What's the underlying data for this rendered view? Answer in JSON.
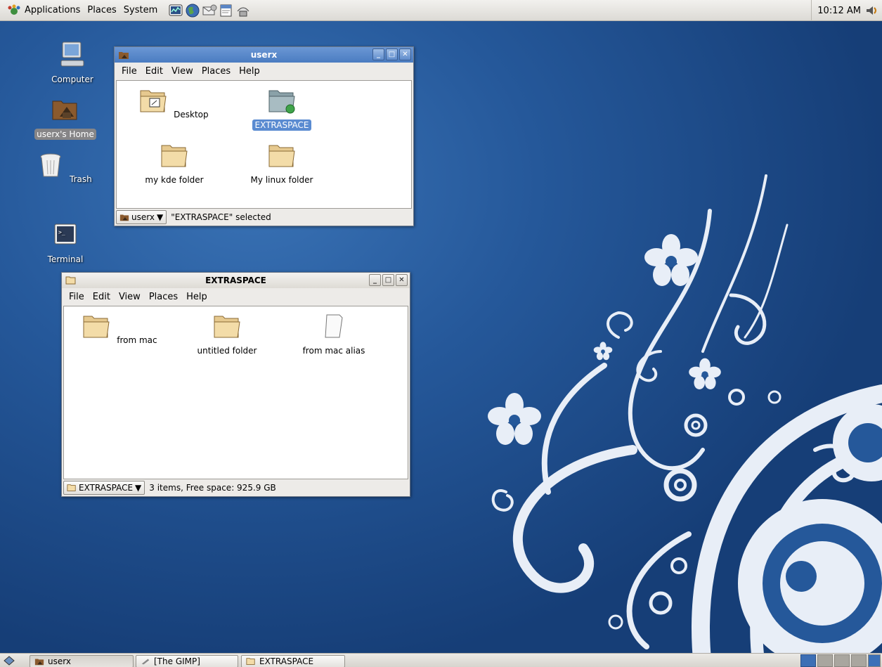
{
  "top_panel": {
    "menus": [
      "Applications",
      "Places",
      "System"
    ],
    "launchers": [
      "system-monitor-icon",
      "web-browser-icon",
      "email-icon",
      "text-editor-icon",
      "network-icon"
    ],
    "clock": "10:12 AM"
  },
  "desktop_icons": [
    {
      "label": "Computer",
      "icon": "computer-icon"
    },
    {
      "label": "userx's Home",
      "icon": "home-folder-icon",
      "selected": true
    },
    {
      "label": "Trash",
      "icon": "trash-icon"
    },
    {
      "label": "Terminal",
      "icon": "terminal-icon"
    }
  ],
  "window_userx": {
    "title": "userx",
    "menus": [
      "File",
      "Edit",
      "View",
      "Places",
      "Help"
    ],
    "items": [
      {
        "name": "Desktop",
        "icon": "desktop-folder-icon"
      },
      {
        "name": "EXTRASPACE",
        "icon": "shared-folder-icon",
        "selected": true
      },
      {
        "name": "my kde folder",
        "icon": "folder-icon"
      },
      {
        "name": "My linux folder",
        "icon": "folder-icon"
      }
    ],
    "location": "userx",
    "status": "\"EXTRASPACE\" selected"
  },
  "window_extraspace": {
    "title": "EXTRASPACE",
    "menus": [
      "File",
      "Edit",
      "View",
      "Places",
      "Help"
    ],
    "items": [
      {
        "name": "from mac",
        "icon": "folder-icon"
      },
      {
        "name": "untitled folder",
        "icon": "folder-icon"
      },
      {
        "name": "from mac alias",
        "icon": "document-icon"
      }
    ],
    "location": "EXTRASPACE",
    "status": "3 items, Free space: 925.9 GB"
  },
  "taskbar": {
    "tasks": [
      "userx",
      "[The GIMP]",
      "EXTRASPACE"
    ]
  },
  "colors": {
    "desktop_blue": "#25589a",
    "title_active": "#4a7cc1",
    "selection": "#5a8bd1"
  }
}
